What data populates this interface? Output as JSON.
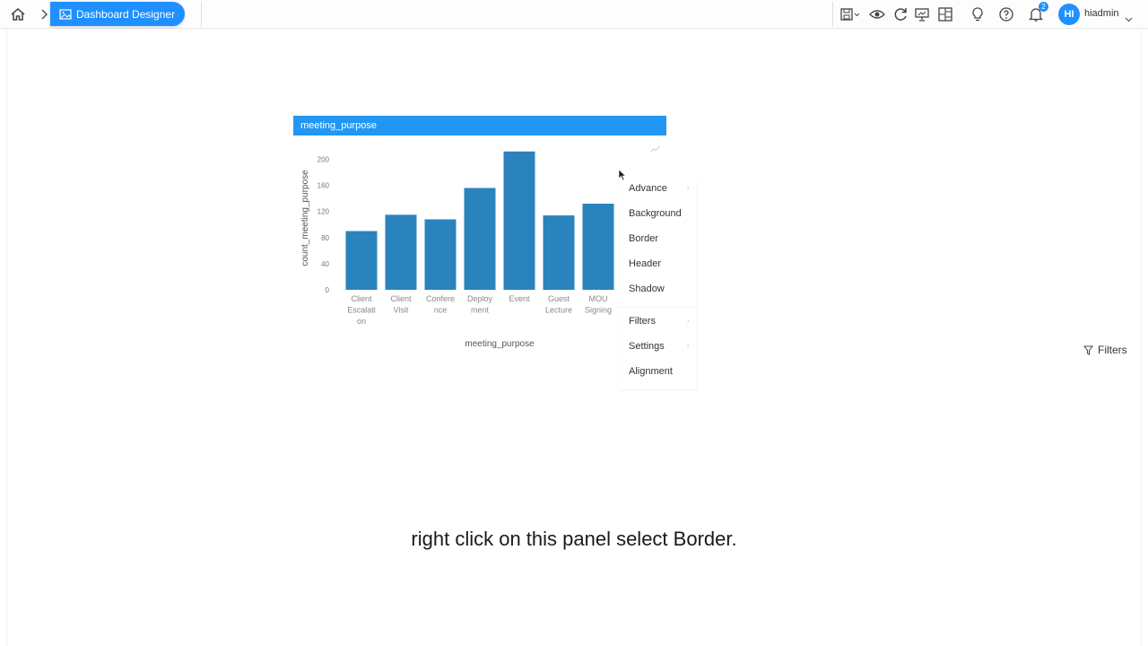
{
  "topbar": {
    "breadcrumb_label": "Dashboard Designer",
    "notification_count": "2",
    "avatar_initials": "HI",
    "username": "hiadmin",
    "icons": [
      "home-icon",
      "save-icon",
      "eye-icon",
      "refresh-icon",
      "presentation-icon",
      "layout-icon",
      "lightbulb-icon",
      "help-icon",
      "bell-icon"
    ],
    "accent_color": "#1e90ff"
  },
  "panel": {
    "title": "meeting_purpose"
  },
  "chart_data": {
    "type": "bar",
    "categories": [
      [
        "Client",
        "Escalati",
        "on"
      ],
      [
        "Client",
        "Visit"
      ],
      [
        "Confere",
        "nce"
      ],
      [
        "Deploy",
        "ment"
      ],
      [
        "Event"
      ],
      [
        "Guest",
        "Lecture"
      ],
      [
        "MOU",
        "Signing"
      ]
    ],
    "values": [
      90,
      115,
      108,
      156,
      212,
      114,
      132
    ],
    "xlabel": "meeting_purpose",
    "ylabel": "count_meeting_purpose",
    "yticks": [
      0,
      40,
      80,
      120,
      160,
      200
    ],
    "ylim": [
      0,
      220
    ],
    "bar_color": "#2a83bd",
    "grid": false
  },
  "context_menu": {
    "items": [
      {
        "label": "Advance",
        "submenu": true
      },
      {
        "label": "Background",
        "submenu": false
      },
      {
        "label": "Border",
        "submenu": false
      },
      {
        "label": "Header",
        "submenu": false
      },
      {
        "label": "Shadow",
        "submenu": false
      },
      {
        "label": "Filters",
        "submenu": true
      },
      {
        "label": "Settings",
        "submenu": true
      },
      {
        "label": "Alignment",
        "submenu": false
      }
    ]
  },
  "filters_button": {
    "label": "Filters"
  },
  "caption": "right click on this panel select Border."
}
